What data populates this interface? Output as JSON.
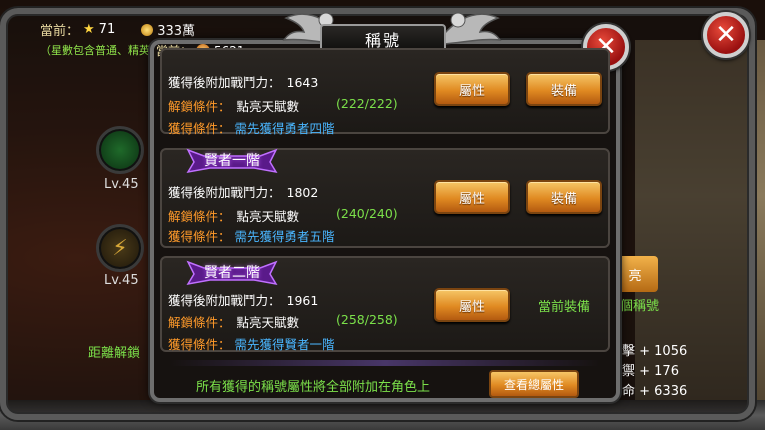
{
  "background": {
    "currency_label": "當前：",
    "stars": "71",
    "coins": "333萬",
    "hint": "（星數包含普通、精英副",
    "level_1": "Lv.45",
    "level_2": "Lv.45",
    "distance_label": "距離解鎖",
    "side_button": "亮",
    "side_green": "個稱號",
    "stat_1": "擊 + 1056",
    "stat_2": "禦 + 176",
    "stat_3": "命 + 6336"
  },
  "dialog": {
    "title": "稱號",
    "gold_label": "當前：",
    "gold_value": "5621",
    "cards": [
      {
        "banner": "",
        "power_label": "獲得後附加戰鬥力：",
        "power_value": "1643",
        "unlock_label": "解鎖條件：",
        "unlock_value": "點亮天賦數",
        "unlock_progress": "(222/222)",
        "obtain_label": "獲得條件：",
        "obtain_value": "需先獲得勇者四階",
        "attr_button": "屬性",
        "equip_button": "裝備"
      },
      {
        "banner": "賢者一階",
        "power_label": "獲得後附加戰鬥力：",
        "power_value": "1802",
        "unlock_label": "解鎖條件：",
        "unlock_value": "點亮天賦數",
        "unlock_progress": "(240/240)",
        "obtain_label": "獲得條件：",
        "obtain_value": "需先獲得勇者五階",
        "attr_button": "屬性",
        "equip_button": "裝備"
      },
      {
        "banner": "賢者二階",
        "power_label": "獲得後附加戰鬥力：",
        "power_value": "1961",
        "unlock_label": "解鎖條件：",
        "unlock_value": "點亮天賦數",
        "unlock_progress": "(258/258)",
        "obtain_label": "獲得條件：",
        "obtain_value": "需先獲得賢者一階",
        "attr_button": "屬性",
        "equipped_text": "當前裝備"
      }
    ],
    "footer_text": "所有獲得的稱號屬性將全部附加在角色上",
    "footer_button": "查看總屬性"
  },
  "colors": {
    "accent_orange": "#ff9a2a",
    "accent_green": "#7be04a",
    "accent_blue": "#4ab6ff",
    "button_gold": "#e08a22",
    "close_red": "#c02020"
  },
  "icons": [
    "star-icon",
    "coin-icon",
    "gold-icon",
    "close-icon",
    "wing-ornament-icon",
    "lightning-icon"
  ]
}
